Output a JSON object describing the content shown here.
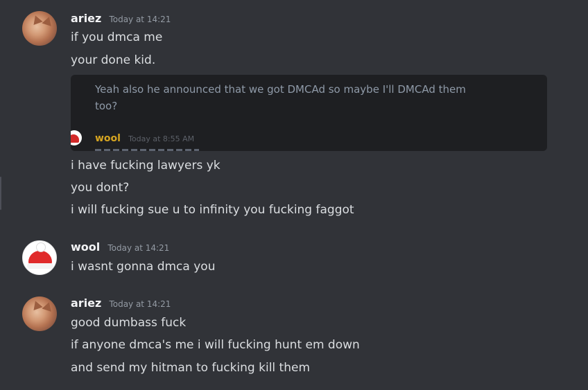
{
  "messages": [
    {
      "username": "ariez",
      "timestamp": "Today at 14:21",
      "lines_before_embed": [
        "if you dmca me",
        "your done kid."
      ],
      "embed": {
        "text": "Yeah also he announced that we got DMCAd so maybe I'll DMCAd them too?",
        "author": "wool",
        "timestamp": "Today at 8:55 AM"
      },
      "lines_after_embed": [
        "i have fucking lawyers yk",
        "you dont?",
        "i will fucking sue u to infinity you fucking faggot"
      ]
    },
    {
      "username": "wool",
      "timestamp": "Today at 14:21",
      "lines": [
        "i wasnt gonna dmca you"
      ]
    },
    {
      "username": "ariez",
      "timestamp": "Today at 14:21",
      "lines": [
        "good dumbass fuck",
        "if anyone dmca's me i will fucking hunt em down",
        "and send my hitman to fucking kill them"
      ]
    }
  ],
  "colors": {
    "background": "#313338",
    "embed_background": "#1e1f22",
    "embed_author": "#d6a521",
    "timestamp": "#949ba4"
  },
  "icons": {
    "ariez_avatar": "cat-avatar",
    "wool_avatar": "santa-hat-avatar"
  }
}
